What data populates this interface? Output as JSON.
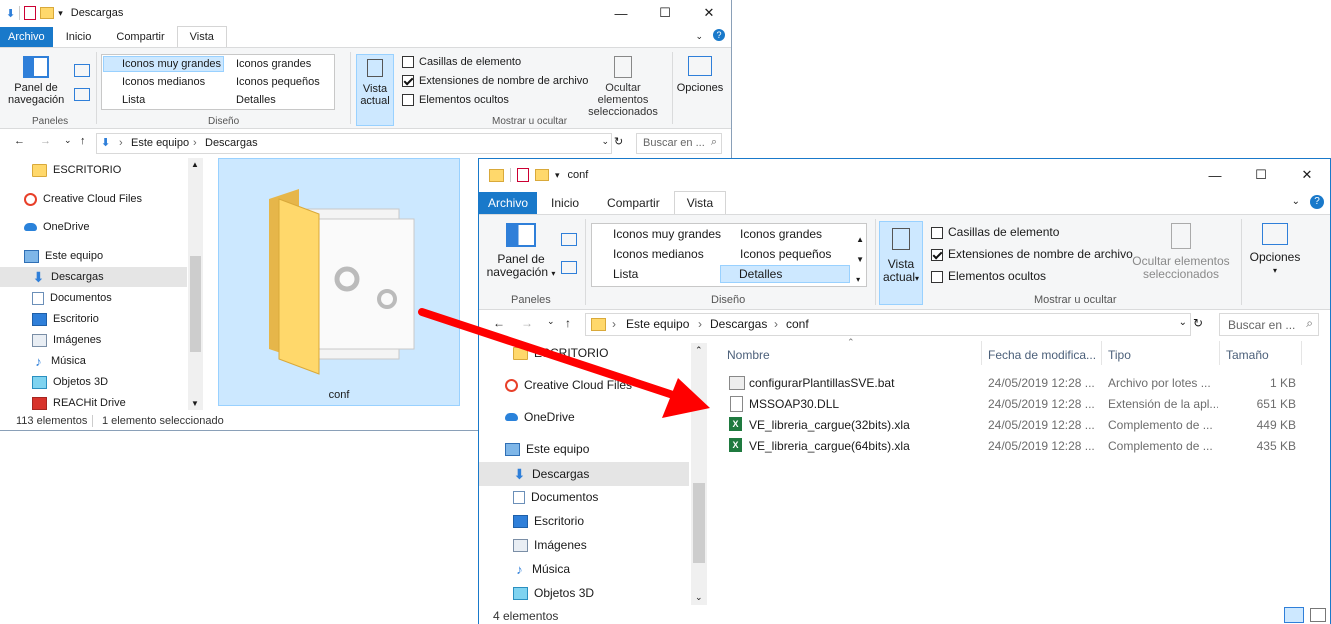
{
  "colors": {
    "accent": "#1979ca",
    "selection": "#cde8ff",
    "arrow": "#ff0000"
  },
  "back_window": {
    "title": "Descargas",
    "tabs": [
      "Archivo",
      "Inicio",
      "Compartir",
      "Vista"
    ],
    "ribbon": {
      "nav_pane": "Panel de navegación",
      "layout_items": [
        "Iconos muy grandes",
        "Iconos grandes",
        "Iconos medianos",
        "Iconos pequeños",
        "Lista",
        "Detalles"
      ],
      "current_view": "Vista actual",
      "checkboxes": [
        "Casillas de elemento",
        "Extensiones de nombre de archivo",
        "Elementos ocultos"
      ],
      "hide_selected": "Ocultar elementos seleccionados",
      "options": "Opciones",
      "groups": [
        "Paneles",
        "Diseño",
        "Mostrar u ocultar"
      ]
    },
    "breadcrumb": [
      "Este equipo",
      "Descargas"
    ],
    "search_placeholder": "Buscar en ...",
    "nav": [
      "ESCRITORIO",
      "Creative Cloud Files",
      "OneDrive",
      "Este equipo",
      "Descargas",
      "Documentos",
      "Escritorio",
      "Imágenes",
      "Música",
      "Objetos 3D",
      "REACHit Drive"
    ],
    "folder_label": "conf",
    "status": {
      "count": "113 elementos",
      "selected": "1 elemento seleccionado"
    }
  },
  "front_window": {
    "title": "conf",
    "tabs": [
      "Archivo",
      "Inicio",
      "Compartir",
      "Vista"
    ],
    "ribbon": {
      "nav_pane_1": "Panel de",
      "nav_pane_2": "navegación",
      "layout_items": [
        "Iconos muy grandes",
        "Iconos grandes",
        "Iconos medianos",
        "Iconos pequeños",
        "Lista",
        "Detalles"
      ],
      "current_view_1": "Vista",
      "current_view_2": "actual",
      "checkboxes": [
        "Casillas de elemento",
        "Extensiones de nombre de archivo",
        "Elementos ocultos"
      ],
      "hide_selected_1": "Ocultar elementos",
      "hide_selected_2": "seleccionados",
      "options": "Opciones",
      "groups": [
        "Paneles",
        "Diseño",
        "Mostrar u ocultar"
      ]
    },
    "breadcrumb": [
      "Este equipo",
      "Descargas",
      "conf"
    ],
    "search_placeholder": "Buscar en ...",
    "nav": [
      "ESCRITORIO",
      "Creative Cloud Files",
      "OneDrive",
      "Este equipo",
      "Descargas",
      "Documentos",
      "Escritorio",
      "Imágenes",
      "Música",
      "Objetos 3D"
    ],
    "columns": [
      "Nombre",
      "Fecha de modifica...",
      "Tipo",
      "Tamaño"
    ],
    "files": [
      {
        "name": "configurarPlantillasSVE.bat",
        "date": "24/05/2019 12:28 ...",
        "type": "Archivo por lotes ...",
        "size": "1 KB",
        "icon": "bat-icon"
      },
      {
        "name": "MSSOAP30.DLL",
        "date": "24/05/2019 12:28 ...",
        "type": "Extensión de la apl...",
        "size": "651 KB",
        "icon": "dll-icon"
      },
      {
        "name": "VE_libreria_cargue(32bits).xla",
        "date": "24/05/2019 12:28 ...",
        "type": "Complemento de ...",
        "size": "449 KB",
        "icon": "excel-icon"
      },
      {
        "name": "VE_libreria_cargue(64bits).xla",
        "date": "24/05/2019 12:28 ...",
        "type": "Complemento de ...",
        "size": "435 KB",
        "icon": "excel-icon"
      }
    ],
    "status": {
      "count": "4 elementos"
    }
  }
}
